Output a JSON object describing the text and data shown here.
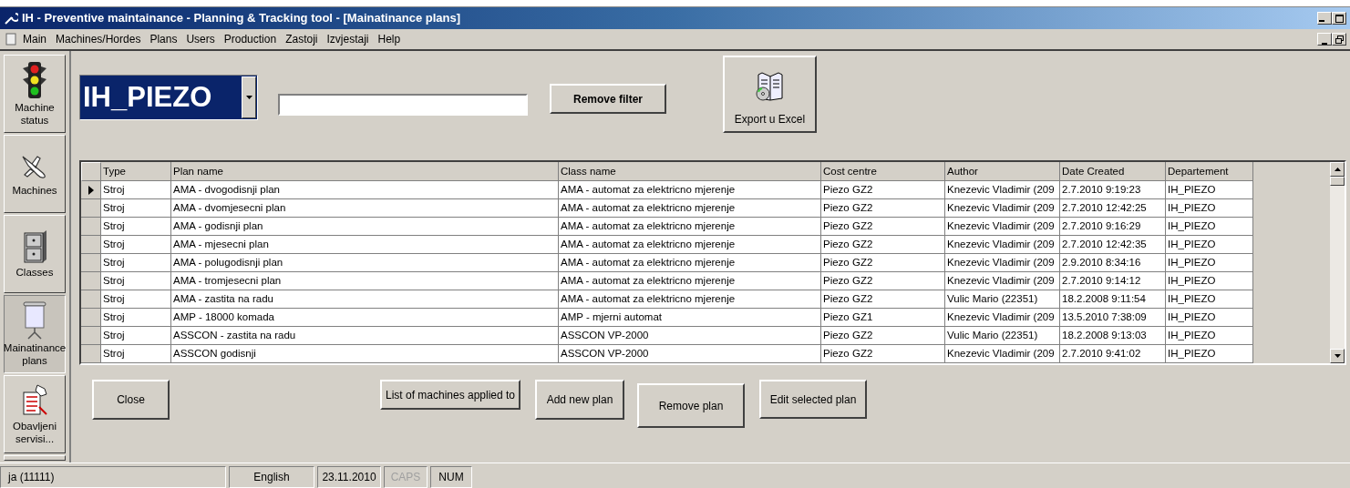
{
  "window": {
    "title": "IH - Preventive maintainance  - Planning & Tracking tool - [Mainatinance plans]"
  },
  "menu": [
    "Main",
    "Machines/Hordes",
    "Plans",
    "Users",
    "Production",
    "Zastoji",
    "Izvjestaji",
    "Help"
  ],
  "sidebar": {
    "items": [
      {
        "kind": "traffic",
        "label": "Machine status",
        "selected": false
      },
      {
        "kind": "plane",
        "label": "Machines",
        "selected": false
      },
      {
        "kind": "cabinet",
        "label": "Classes",
        "selected": false
      },
      {
        "kind": "screen",
        "label": "Mainatinance plans",
        "selected": true
      },
      {
        "kind": "service",
        "label": "Obavljeni servisi...",
        "selected": false
      }
    ]
  },
  "filter": {
    "department": "IH_PIEZO",
    "remove_button": "Remove filter",
    "export_button": "Export u Excel"
  },
  "table": {
    "columns": [
      "Type",
      "Plan name",
      "Class name",
      "Cost centre",
      "Author",
      "Date Created",
      "Departement"
    ],
    "rows": [
      {
        "selected": true,
        "cells": [
          "Stroj",
          "AMA - dvogodisnji plan",
          "AMA - automat za elektricno mjerenje",
          "Piezo GZ2",
          "Knezevic Vladimir (209",
          "2.7.2010 9:19:23",
          "IH_PIEZO"
        ]
      },
      {
        "selected": false,
        "cells": [
          "Stroj",
          "AMA - dvomjesecni plan",
          "AMA - automat za elektricno mjerenje",
          "Piezo GZ2",
          "Knezevic Vladimir (209",
          "2.7.2010 12:42:25",
          "IH_PIEZO"
        ]
      },
      {
        "selected": false,
        "cells": [
          "Stroj",
          "AMA - godisnji plan",
          "AMA - automat za elektricno mjerenje",
          "Piezo GZ2",
          "Knezevic Vladimir (209",
          "2.7.2010 9:16:29",
          "IH_PIEZO"
        ]
      },
      {
        "selected": false,
        "cells": [
          "Stroj",
          "AMA - mjesecni plan",
          "AMA - automat za elektricno mjerenje",
          "Piezo GZ2",
          "Knezevic Vladimir (209",
          "2.7.2010 12:42:35",
          "IH_PIEZO"
        ]
      },
      {
        "selected": false,
        "cells": [
          "Stroj",
          "AMA - polugodisnji plan",
          "AMA - automat za elektricno mjerenje",
          "Piezo GZ2",
          "Knezevic Vladimir (209",
          "2.9.2010 8:34:16",
          "IH_PIEZO"
        ]
      },
      {
        "selected": false,
        "cells": [
          "Stroj",
          "AMA - tromjesecni plan",
          "AMA - automat za elektricno mjerenje",
          "Piezo GZ2",
          "Knezevic Vladimir (209",
          "2.7.2010 9:14:12",
          "IH_PIEZO"
        ]
      },
      {
        "selected": false,
        "cells": [
          "Stroj",
          "AMA - zastita na radu",
          "AMA - automat za elektricno mjerenje",
          "Piezo GZ2",
          "Vulic Mario (22351)",
          "18.2.2008 9:11:54",
          "IH_PIEZO"
        ]
      },
      {
        "selected": false,
        "cells": [
          "Stroj",
          "AMP - 18000 komada",
          "AMP - mjerni automat",
          "Piezo GZ1",
          "Knezevic Vladimir (209",
          "13.5.2010 7:38:09",
          "IH_PIEZO"
        ]
      },
      {
        "selected": false,
        "cells": [
          "Stroj",
          "ASSCON - zastita na radu",
          "ASSCON VP-2000",
          "Piezo GZ2",
          "Vulic Mario (22351)",
          "18.2.2008 9:13:03",
          "IH_PIEZO"
        ]
      },
      {
        "selected": false,
        "cells": [
          "Stroj",
          "ASSCON godisnji",
          "ASSCON VP-2000",
          "Piezo GZ2",
          "Knezevic Vladimir (209",
          "2.7.2010 9:41:02",
          "IH_PIEZO"
        ]
      }
    ]
  },
  "actions": [
    "Close",
    "List of machines applied to",
    "Add new plan",
    "Remove plan",
    "Edit selected plan"
  ],
  "status_bar": [
    {
      "text": "ja (11111)",
      "disabled": false
    },
    {
      "text": "English",
      "disabled": false
    },
    {
      "text": "23.11.2010",
      "disabled": false
    },
    {
      "text": "CAPS",
      "disabled": true
    },
    {
      "text": "NUM",
      "disabled": false
    }
  ]
}
